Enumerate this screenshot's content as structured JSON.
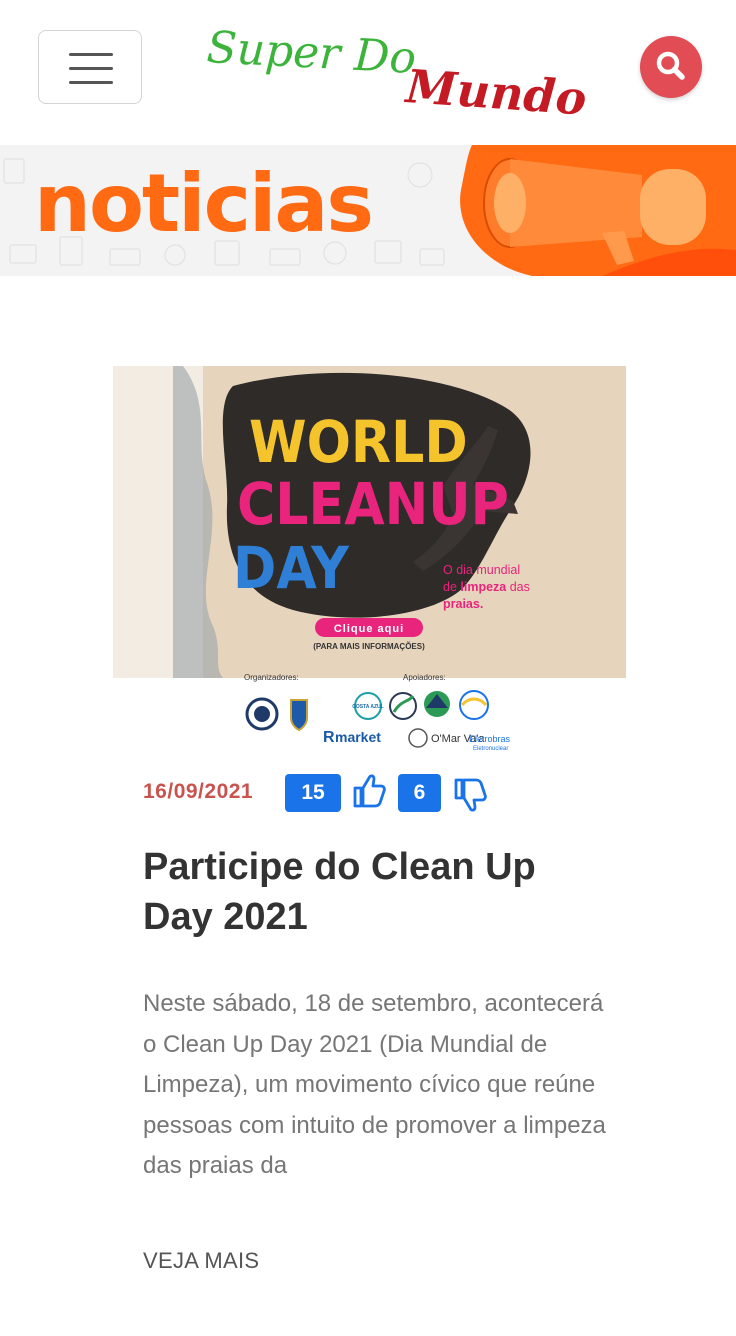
{
  "header": {
    "logo": {
      "line1": "Super Do",
      "line2": "Mundo",
      "color_line1": "#3cb43c",
      "color_line2": "#c41a24"
    },
    "menu_icon": "hamburger-icon",
    "search_icon": "search-icon",
    "search_color": "#e14c55"
  },
  "banner": {
    "title": "noticias",
    "title_color": "#ff6a13",
    "icon": "megaphone-icon"
  },
  "article": {
    "image": {
      "headline": [
        "WORLD",
        "CLEANUP",
        "DAY"
      ],
      "subtitle_1": "O dia mundial",
      "subtitle_2_pre": "de ",
      "subtitle_2_bold": "limpeza",
      "subtitle_2_post": " das",
      "subtitle_3": "praias.",
      "cta": "Clique aqui",
      "cta_sub": "(PARA MAIS INFORMAÇÕES)",
      "organizers_label": "Organizadores:",
      "supporters_label": "Apoiadores:",
      "supporter_costa": "COSTA AZUL",
      "supporter_market": "market",
      "supporter_marvaa": "O'Mar Va'a",
      "supporter_eletrobras": "Eletrobras",
      "supporter_eletronuclear": "Eletronuclear"
    },
    "date": "16/09/2021",
    "likes": "15",
    "dislikes": "6",
    "title": "Participe do Clean Up Day 2021",
    "excerpt": "Neste sábado, 18 de setembro, acontecerá o Clean Up Day 2021 (Dia Mundial de Limpeza), um movimento cívico que reúne pessoas com intuito de promover a limpeza das praias da",
    "read_more": "VEJA MAIS"
  },
  "colors": {
    "accent_blue": "#1a73e8",
    "date_red": "#c9534f",
    "cta_pink": "#e8247c"
  }
}
